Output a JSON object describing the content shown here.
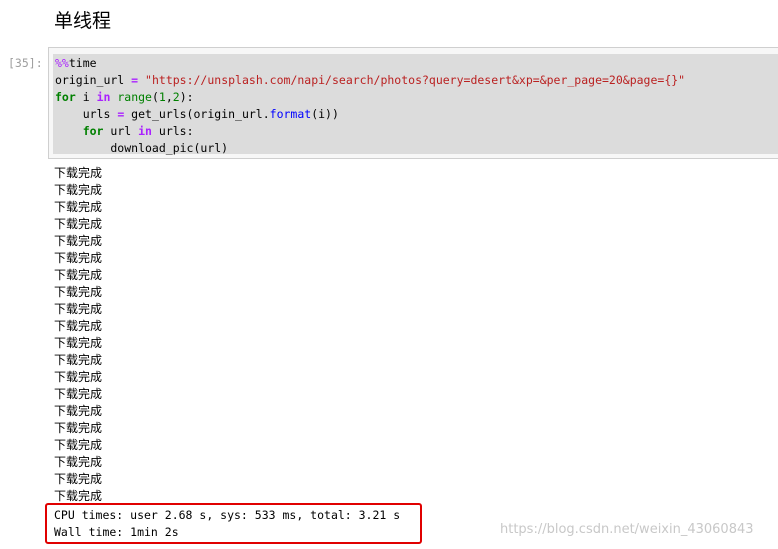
{
  "heading": "单线程",
  "cell": {
    "prompt": "[35]:",
    "code_lines": [
      [
        {
          "t": "%%",
          "c": "magic"
        },
        {
          "t": "time",
          "c": ""
        }
      ],
      [
        {
          "t": "origin_url ",
          "c": ""
        },
        {
          "t": "=",
          "c": "op"
        },
        {
          "t": " ",
          "c": ""
        },
        {
          "t": "\"https://unsplash.com/napi/search/photos?query=desert&xp=&per_page=20&page={}\"",
          "c": "str"
        }
      ],
      [
        {
          "t": "for",
          "c": "kw"
        },
        {
          "t": " i ",
          "c": ""
        },
        {
          "t": "in",
          "c": "op"
        },
        {
          "t": " ",
          "c": ""
        },
        {
          "t": "range",
          "c": "bi"
        },
        {
          "t": "(",
          "c": ""
        },
        {
          "t": "1",
          "c": "num"
        },
        {
          "t": ",",
          "c": ""
        },
        {
          "t": "2",
          "c": "num"
        },
        {
          "t": "):",
          "c": ""
        }
      ],
      [
        {
          "t": "    urls ",
          "c": ""
        },
        {
          "t": "=",
          "c": "op"
        },
        {
          "t": " get_urls(origin_url.",
          "c": ""
        },
        {
          "t": "format",
          "c": "meth"
        },
        {
          "t": "(i))",
          "c": ""
        }
      ],
      [
        {
          "t": "    ",
          "c": ""
        },
        {
          "t": "for",
          "c": "kw"
        },
        {
          "t": " url ",
          "c": ""
        },
        {
          "t": "in",
          "c": "op"
        },
        {
          "t": " urls:",
          "c": ""
        }
      ],
      [
        {
          "t": "        download_pic(url)",
          "c": ""
        }
      ]
    ]
  },
  "output": {
    "lines": [
      "下载完成",
      "下载完成",
      "下载完成",
      "下载完成",
      "下载完成",
      "下载完成",
      "下载完成",
      "下载完成",
      "下载完成",
      "下载完成",
      "下载完成",
      "下载完成",
      "下载完成",
      "下载完成",
      "下载完成",
      "下载完成",
      "下载完成",
      "下载完成",
      "下载完成",
      "下载完成"
    ],
    "cpu_times": "CPU times: user 2.68 s, sys: 533 ms, total: 3.21 s",
    "wall_time": "Wall time: 1min 2s"
  },
  "watermark": "https://blog.csdn.net/weixin_43060843",
  "colors": {
    "highlight_box": "#e00000",
    "cell_background": "#f7f7f7",
    "selection": "#dcdcdc"
  }
}
